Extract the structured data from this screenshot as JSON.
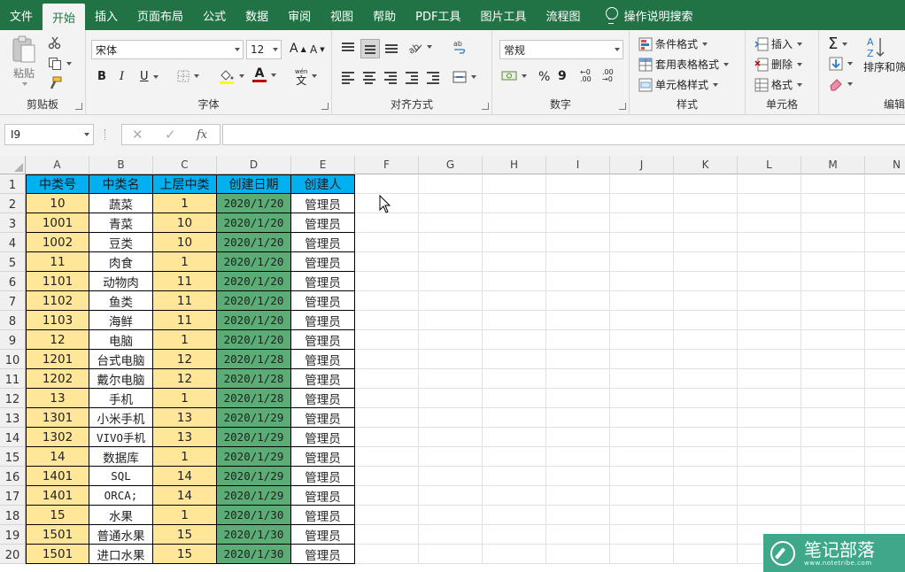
{
  "menu": {
    "tabs": [
      "文件",
      "开始",
      "插入",
      "页面布局",
      "公式",
      "数据",
      "审阅",
      "视图",
      "帮助",
      "PDF工具",
      "图片工具",
      "流程图"
    ],
    "active_index": 1,
    "tell_me": "操作说明搜索"
  },
  "ribbon": {
    "clipboard": {
      "label": "剪贴板",
      "paste": "粘贴"
    },
    "font": {
      "label": "字体",
      "name": "宋体",
      "size": "12",
      "bold": "B",
      "italic": "I",
      "underline": "U",
      "grow": "A",
      "shrink": "A",
      "color_letter": "A",
      "phonetic_top": "wén",
      "phonetic": "文"
    },
    "alignment": {
      "label": "对齐方式"
    },
    "number": {
      "label": "数字",
      "format": "常规",
      "percent": "%",
      "comma": "9",
      "inc_decimal": "←0\n.00",
      "dec_decimal": ".00\n→0"
    },
    "styles": {
      "label": "样式",
      "conditional": "条件格式",
      "table": "套用表格格式",
      "cell": "单元格样式"
    },
    "cells": {
      "label": "单元格",
      "insert": "插入",
      "delete": "删除",
      "format": "格式"
    },
    "editing": {
      "label": "编辑",
      "sort": "排序和筛"
    }
  },
  "formula_bar": {
    "name_box": "I9",
    "cancel": "✕",
    "enter": "✓",
    "fx": "fx",
    "value": ""
  },
  "columns": [
    "A",
    "B",
    "C",
    "D",
    "E",
    "F",
    "G",
    "H",
    "I",
    "J",
    "K",
    "L",
    "M",
    "N"
  ],
  "rows": [
    "1",
    "2",
    "3",
    "4",
    "5",
    "6",
    "7",
    "8",
    "9",
    "10",
    "11",
    "12",
    "13",
    "14",
    "15",
    "16",
    "17",
    "18",
    "19",
    "20"
  ],
  "colors": {
    "ribbon_green": "#217346",
    "header_blue": "#00b0f0",
    "id_yellow": "#ffe699",
    "date_green": "#5aad75"
  },
  "table": {
    "headers": [
      "中类号",
      "中类名",
      "上层中类",
      "创建日期",
      "创建人"
    ],
    "rows": [
      [
        "10",
        "蔬菜",
        "1",
        "2020/1/20",
        "管理员"
      ],
      [
        "1001",
        "青菜",
        "10",
        "2020/1/20",
        "管理员"
      ],
      [
        "1002",
        "豆类",
        "10",
        "2020/1/20",
        "管理员"
      ],
      [
        "11",
        "肉食",
        "1",
        "2020/1/20",
        "管理员"
      ],
      [
        "1101",
        "动物肉",
        "11",
        "2020/1/20",
        "管理员"
      ],
      [
        "1102",
        "鱼类",
        "11",
        "2020/1/20",
        "管理员"
      ],
      [
        "1103",
        "海鲜",
        "11",
        "2020/1/20",
        "管理员"
      ],
      [
        "12",
        "电脑",
        "1",
        "2020/1/20",
        "管理员"
      ],
      [
        "1201",
        "台式电脑",
        "12",
        "2020/1/28",
        "管理员"
      ],
      [
        "1202",
        "戴尔电脑",
        "12",
        "2020/1/28",
        "管理员"
      ],
      [
        "13",
        "手机",
        "1",
        "2020/1/28",
        "管理员"
      ],
      [
        "1301",
        "小米手机",
        "13",
        "2020/1/29",
        "管理员"
      ],
      [
        "1302",
        "VIVO手机",
        "13",
        "2020/1/29",
        "管理员"
      ],
      [
        "14",
        "数据库",
        "1",
        "2020/1/29",
        "管理员"
      ],
      [
        "1401",
        "SQL",
        "14",
        "2020/1/29",
        "管理员"
      ],
      [
        "1401",
        "ORCA;",
        "14",
        "2020/1/29",
        "管理员"
      ],
      [
        "15",
        "水果",
        "1",
        "2020/1/30",
        "管理员"
      ],
      [
        "1501",
        "普通水果",
        "15",
        "2020/1/30",
        "管理员"
      ],
      [
        "1501",
        "进口水果",
        "15",
        "2020/1/30",
        "管理员"
      ]
    ]
  },
  "watermark": {
    "title": "笔记部落",
    "url": "www.notetribe.com"
  }
}
